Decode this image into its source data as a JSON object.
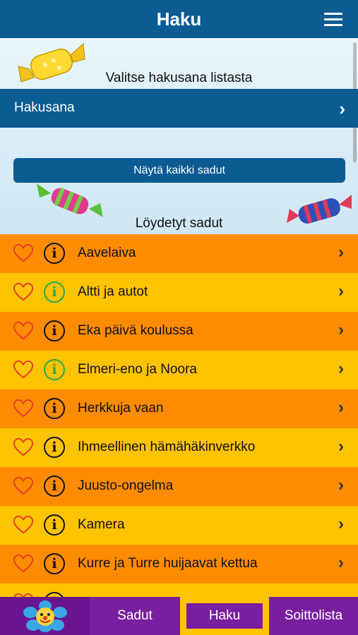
{
  "header": {
    "title": "Haku",
    "menu_icon": "hamburger-menu-icon"
  },
  "search": {
    "prompt": "Valitse hakusana listasta",
    "field_label": "Hakusana",
    "show_all_label": "Näytä kaikki sadut",
    "results_heading": "Löydetyt sadut"
  },
  "colors": {
    "header_blue": "#0d5b93",
    "orange_row": "#ff8c00",
    "yellow_row": "#ffc300",
    "tab_purple": "#7a1ea0",
    "heart_red": "#e63a25",
    "info_green": "#2aa84a"
  },
  "stories": [
    {
      "title": "Aavelaiva",
      "info_status": "black"
    },
    {
      "title": "Altti ja autot",
      "info_status": "green"
    },
    {
      "title": "Eka päivä koulussa",
      "info_status": "black"
    },
    {
      "title": "Elmeri-eno ja Noora",
      "info_status": "green"
    },
    {
      "title": "Herkkuja vaan",
      "info_status": "black"
    },
    {
      "title": "Ihmeellinen hämähäkinverkko",
      "info_status": "black"
    },
    {
      "title": "Juusto-ongelma",
      "info_status": "black"
    },
    {
      "title": "Kamera",
      "info_status": "black"
    },
    {
      "title": "Kurre ja Turre huijaavat kettua",
      "info_status": "black"
    },
    {
      "title": "",
      "info_status": "black"
    }
  ],
  "tabs": {
    "home_icon": "flower-face-icon",
    "sadut": "Sadut",
    "haku": "Haku",
    "soittolista": "Soittolista",
    "active": "Haku"
  }
}
